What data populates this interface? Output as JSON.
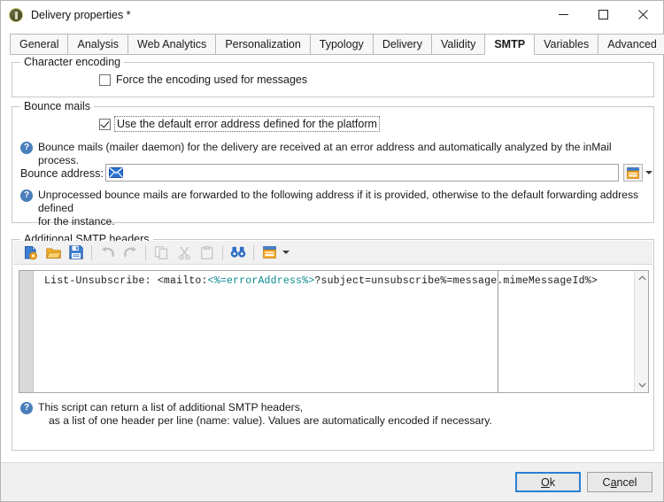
{
  "window": {
    "title": "Delivery properties *",
    "icon": "app-icon",
    "controls": {
      "minimize": "minimize-icon",
      "maximize": "maximize-icon",
      "close": "close-icon"
    }
  },
  "tabs": [
    {
      "label": "General",
      "active": false
    },
    {
      "label": "Analysis",
      "active": false
    },
    {
      "label": "Web Analytics",
      "active": false
    },
    {
      "label": "Personalization",
      "active": false
    },
    {
      "label": "Typology",
      "active": false
    },
    {
      "label": "Delivery",
      "active": false
    },
    {
      "label": "Validity",
      "active": false
    },
    {
      "label": "SMTP",
      "active": true
    },
    {
      "label": "Variables",
      "active": false
    },
    {
      "label": "Advanced",
      "active": false
    }
  ],
  "character_encoding": {
    "legend": "Character encoding",
    "force_encoding": {
      "label": "Force the encoding used for messages",
      "checked": false
    }
  },
  "bounce_mails": {
    "legend": "Bounce mails",
    "use_default_error_address": {
      "label": "Use the default error address defined for the platform",
      "checked": true,
      "focused": true
    },
    "info1": "Bounce mails (mailer daemon) for the delivery are received at an error address and automatically analyzed by the inMail process.",
    "address_label": "Bounce address:",
    "address_value": "",
    "address_icon": "envelope-icon",
    "picker_icon": "window-picker-icon",
    "info2_line1": "Unprocessed bounce mails are forwarded to the following address if it is provided, otherwise to the default forwarding address defined",
    "info2_line2": "for the instance."
  },
  "smtp_headers": {
    "legend": "Additional SMTP headers",
    "toolbar": [
      {
        "name": "new-icon",
        "enabled": true
      },
      {
        "name": "open-folder-icon",
        "enabled": true
      },
      {
        "name": "save-icon",
        "enabled": true
      },
      {
        "name": "undo-icon",
        "enabled": false
      },
      {
        "name": "redo-icon",
        "enabled": false
      },
      {
        "name": "copy-icon",
        "enabled": false
      },
      {
        "name": "cut-icon",
        "enabled": false
      },
      {
        "name": "paste-icon",
        "enabled": false
      },
      {
        "name": "find-icon",
        "enabled": true
      },
      {
        "name": "insert-field-icon",
        "enabled": true
      }
    ],
    "code": {
      "prefix": "List-Unsubscribe: <mailto:",
      "variable1": "<%=errorAddress%>",
      "middle": "?subject=unsubscribe",
      "variable2": "%=message.mimeMessageId%",
      "suffix": ">"
    },
    "help_line1": "This script can return a list of additional SMTP headers,",
    "help_line2": "as a list of one header per line (name: value). Values are automatically encoded if necessary."
  },
  "footer": {
    "ok": {
      "prefix": "",
      "accel": "O",
      "suffix": "k"
    },
    "cancel": {
      "prefix": "C",
      "accel": "a",
      "suffix": "ncel"
    }
  },
  "colors": {
    "accent": "#2a7fd4",
    "info_badge": "#4a7ebb",
    "code_variable": "#0b8a8f",
    "orange": "#f0a02a"
  }
}
